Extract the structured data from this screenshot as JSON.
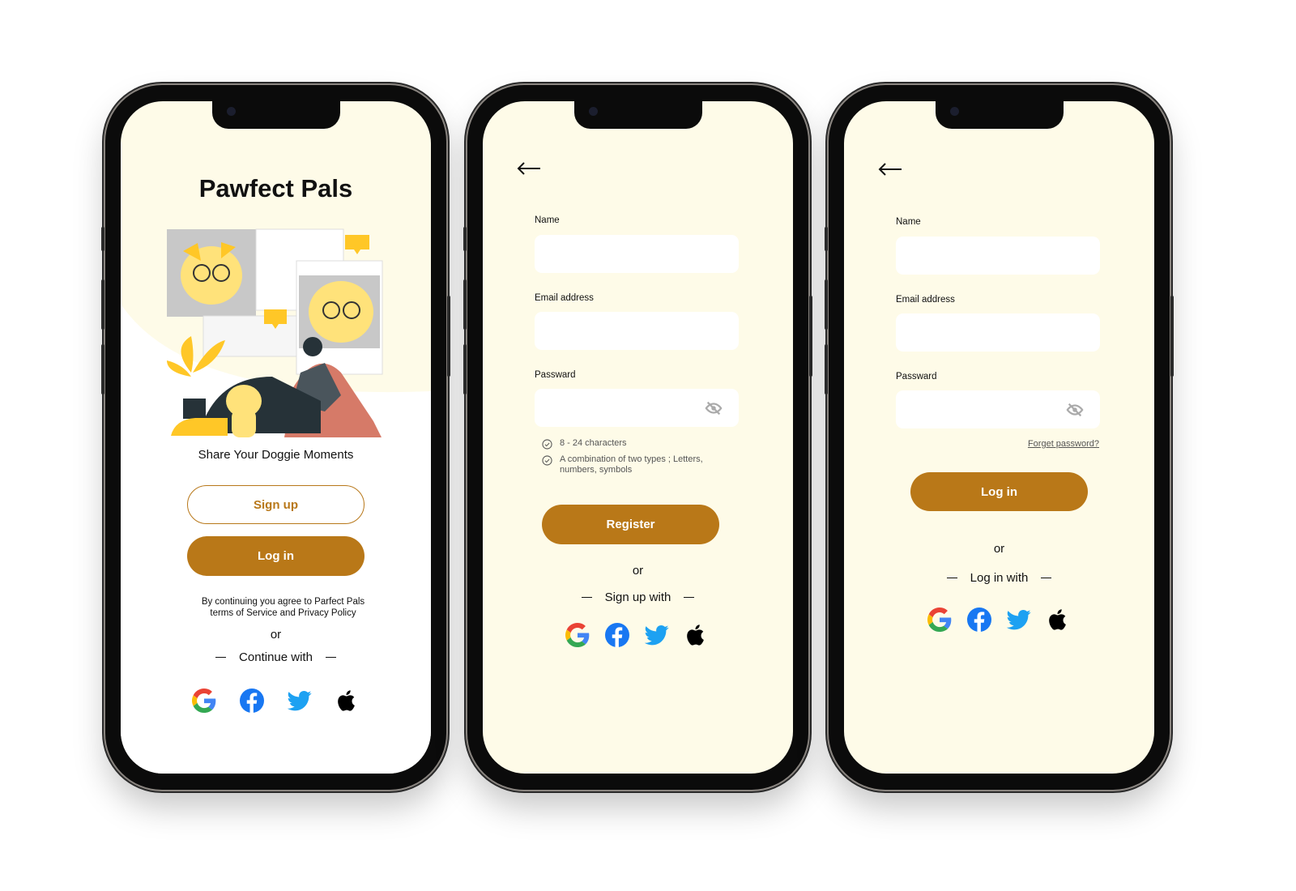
{
  "colors": {
    "brand": "#b97818",
    "screen_bg": "#fefbe8",
    "input_bg": "#ffffff",
    "illustration_yellow": "#ffc727"
  },
  "welcome": {
    "title": "Pawfect Pals",
    "tagline": "Share Your Doggie Moments",
    "signup_label": "Sign up",
    "login_label": "Log in",
    "terms_line1": "By continuing you agree  to Parfect Pals",
    "terms_line2": "terms of Service and Privacy Policy",
    "or": "or",
    "continue_with": "Continue with",
    "social": [
      "google-icon",
      "facebook-icon",
      "twitter-icon",
      "apple-icon"
    ]
  },
  "register": {
    "back_icon": "arrow-left-icon",
    "name_label": "Name",
    "email_label": "Email address",
    "password_label": "Passward",
    "name_value": "",
    "email_value": "",
    "password_value": "",
    "rules": [
      "8 - 24 characters",
      "A combination of two types ; Letters, numbers, symbols"
    ],
    "register_label": "Register",
    "or": "or",
    "signup_with": "Sign up with"
  },
  "login": {
    "back_icon": "arrow-left-icon",
    "name_label": "Name",
    "email_label": "Email address",
    "password_label": "Passward",
    "name_value": "",
    "email_value": "",
    "password_value": "",
    "forgot_label": "Forget password?",
    "login_label": "Log in",
    "or": "or",
    "login_with": "Log in with"
  }
}
